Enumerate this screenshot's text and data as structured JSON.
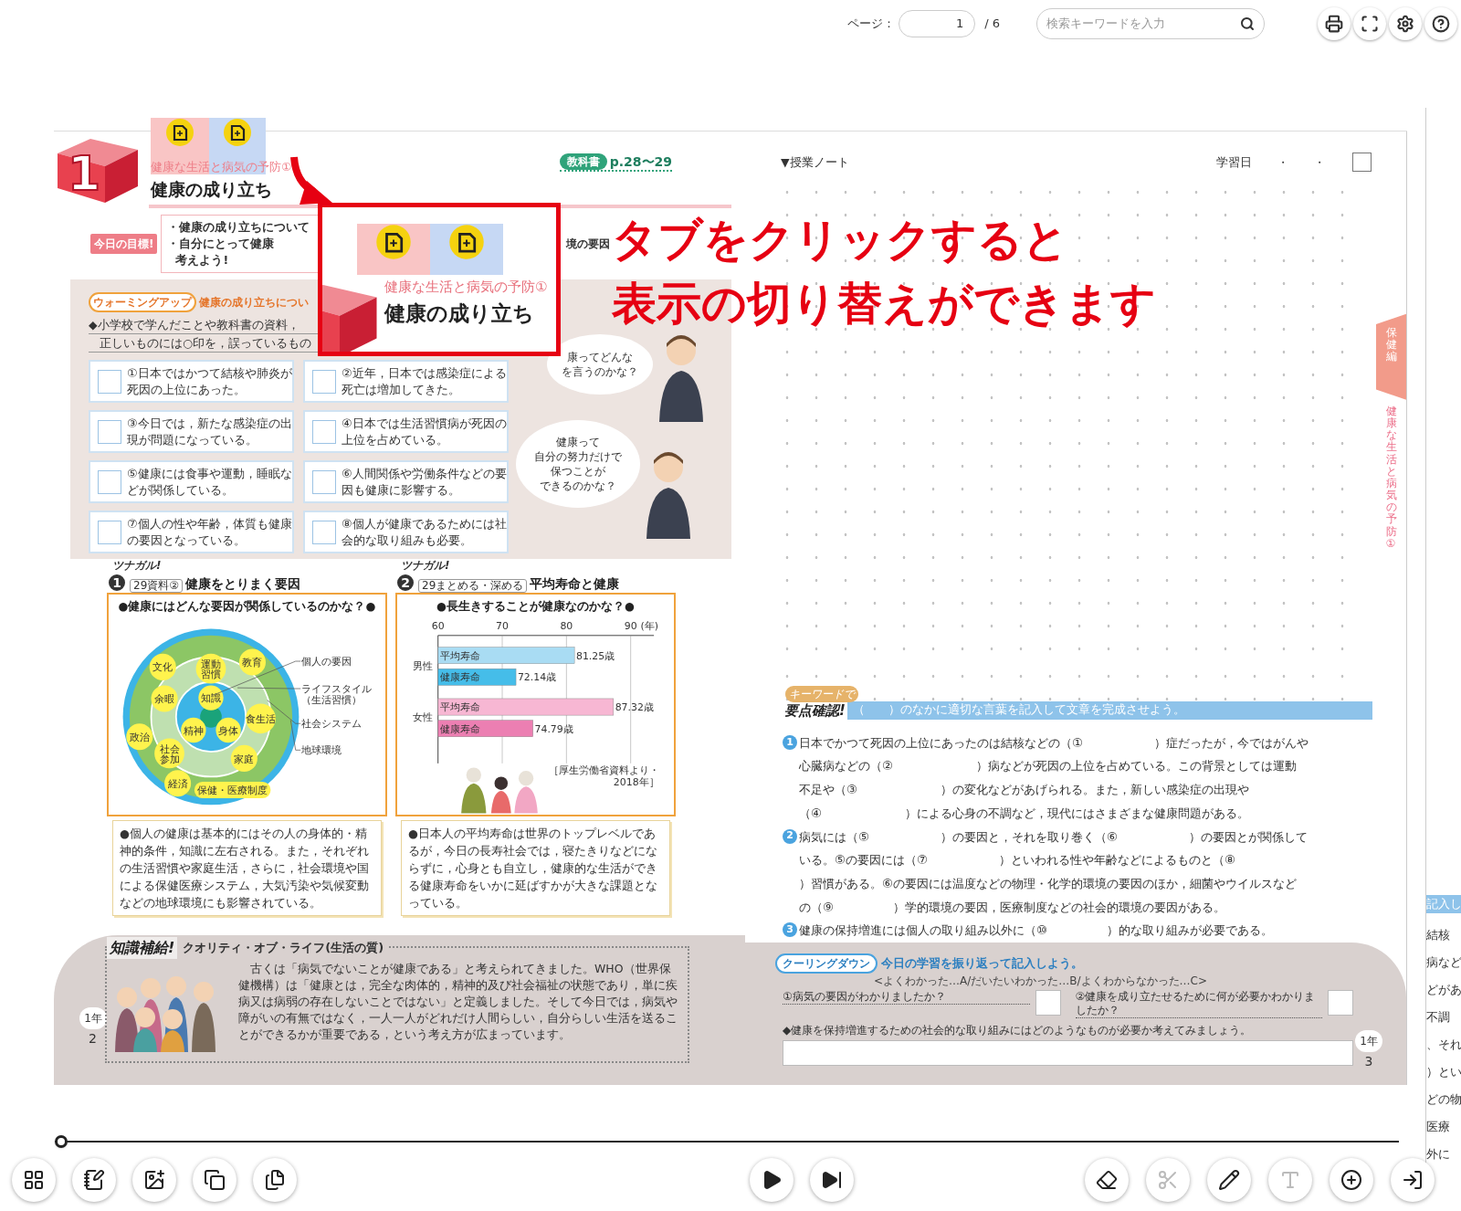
{
  "top_bar": {
    "page_label": "ページ：",
    "page_value": "1",
    "page_total": "/ 6",
    "search": {
      "placeholder": "検索キーワードを入力"
    }
  },
  "left_page": {
    "lesson_number": "1",
    "subtitle": "健康な生活と病気の予防①",
    "title": "健康の成り立ち",
    "textbook_badge": "教科書",
    "textbook_pages": "p.28〜29",
    "goal_badge": "今日の目標!",
    "goal_lines": [
      "・健康の成り立ちについて",
      "・自分にとって健康",
      "考えよう!"
    ],
    "goal_right_text": "境の要因",
    "warmup": {
      "badge": "ウォーミングアップ",
      "heading": "健康の成り立ちについ",
      "instruction_lines": [
        "◆小学校で学んだことや教科書の資料，",
        "正しいものには○印を，誤っているもの"
      ],
      "statements": [
        {
          "checked": false,
          "text": "①日本ではかつて結核や肺炎が死因の上位にあった。"
        },
        {
          "checked": false,
          "text": "②近年，日本では感染症による死亡は増加してきた。"
        },
        {
          "checked": false,
          "text": "③今日では，新たな感染症の出現が問題になっている。"
        },
        {
          "checked": false,
          "text": "④日本では生活習慣病が死因の上位を占めている。"
        },
        {
          "checked": false,
          "text": "⑤健康には食事や運動，睡眠などが関係している。"
        },
        {
          "checked": false,
          "text": "⑥人間関係や労働条件などの要因も健康に影響する。"
        },
        {
          "checked": false,
          "text": "⑦個人の性や年齢，体質も健康の要因となっている。"
        },
        {
          "checked": false,
          "text": "⑧個人が健康であるためには社会的な取り組みも必要。"
        }
      ],
      "bubbles": [
        {
          "lines": [
            "康ってどんな",
            "を言うのかな？"
          ]
        },
        {
          "lines": [
            "健康って",
            "自分の努力だけで",
            "保つことが",
            "できるのかな？"
          ]
        }
      ]
    },
    "sources": [
      {
        "tag": "ツナガル!",
        "number": "1",
        "ref": "29資料②",
        "title": "健康をとりまく要因",
        "question": "●健康にはどんな要因が関係しているのかな？●",
        "factors": [
          {
            "label": "文化"
          },
          {
            "label": "運動習慣"
          },
          {
            "label": "教育"
          },
          {
            "label": "余暇"
          },
          {
            "label": "知識"
          },
          {
            "label": "食生活"
          },
          {
            "label": "精神"
          },
          {
            "label": "身体"
          },
          {
            "label": "政治"
          },
          {
            "label": "社会参加"
          },
          {
            "label": "家庭"
          },
          {
            "label": "経済"
          },
          {
            "label": "保健・医療制度"
          }
        ],
        "legend": [
          {
            "lines": [
              "個人の要因"
            ]
          },
          {
            "lines": [
              "ライフスタイル",
              "（生活習慣）"
            ]
          },
          {
            "lines": [
              "社会システム"
            ]
          },
          {
            "lines": [
              "地球環境"
            ]
          }
        ],
        "caption": "●個人の健康は基本的にはその人の身体的・精神的条件，知識に左右される。また，それぞれの生活習慣や家庭生活，さらに，社会環境や国による保健医療システム，大気汚染や気候変動などの地球環境にも影響されている。"
      },
      {
        "tag": "ツナガル!",
        "number": "2",
        "ref": "29まとめる・深める",
        "title": "平均寿命と健康",
        "question": "●長生きすることが健康なのかな？●",
        "chart_data": {
          "type": "bar",
          "orientation": "horizontal",
          "xlabel": "(年)",
          "categories": [
            "男性",
            "女性"
          ],
          "xlim": [
            60,
            90
          ],
          "xticks": [
            60,
            70,
            80,
            90
          ],
          "series": [
            {
              "name": "平均寿命",
              "colors": [
                "#a9dcf3",
                "#f7b7d3"
              ],
              "values": [
                81.25,
                87.32
              ]
            },
            {
              "name": "健康寿命",
              "colors": [
                "#45bde9",
                "#ec7fb2"
              ],
              "values": [
                72.14,
                74.79
              ]
            }
          ],
          "value_labels": [
            [
              "81.25歳",
              "87.32歳"
            ],
            [
              "72.14歳",
              "74.79歳"
            ]
          ]
        },
        "source_lines": [
          "［厚生労働省資料より・",
          "2018年］"
        ],
        "caption": "●日本人の平均寿命は世界のトップレベルであるが，今日の長寿社会では，寝たきりなどにならずに，心身とも自立し，健康的な生活ができる健康寿命をいかに延ばすかが大きな課題となっている。"
      }
    ],
    "knowledge": {
      "badge": "知識補給!",
      "title": "クオリティ・オブ・ライフ(生活の質)",
      "text": "　古くは「病気でないことが健康である」と考えられてきました。WHO（世界保健機構）は「健康とは，完全な肉体的，精神的及び社会福祉の状態であり，単に疾病又は病弱の存在しないことではない」と定義しました。そして今日では，病気や障がいの有無ではなく，一人一人がどれだけ人間らしい，自分らしい生活を送ることができるかが重要である，という考え方が広まっています。"
    },
    "grade": "1年",
    "page_number": "2"
  },
  "overlay": {
    "subtitle": "健康な生活と病気の予防①",
    "title": "健康の成り立ち",
    "message_lines": [
      "タブをクリックすると",
      "表示の切り替えができます"
    ]
  },
  "right_page": {
    "note_label": "▼授業ノート",
    "date_label": "学習日",
    "date_dots": [
      "・",
      "・"
    ],
    "date_checked": false,
    "side_tab": "保健編",
    "side_title": "健康な生活と病気の予防①",
    "keypoints": {
      "tag": "キーワードで",
      "badge": "要点確認!",
      "instruction": "（　　）のなかに適切な言葉を記入して文章を完成させよう。",
      "items": [
        {
          "number": "1",
          "lines": [
            "日本でかつて死因の上位にあったのは結核などの（①　　　　　　）症だったが，今ではがんや",
            "心臓病などの（②　　　　　　　）病などが死因の上位を占めている。この背景としては運動",
            "不足や（③　　　　　　　）の変化などがあげられる。また，新しい感染症の出現や",
            "（④　　　　　　　）による心身の不調など，現代にはさまざまな健康問題がある。"
          ]
        },
        {
          "number": "2",
          "lines": [
            "病気には（⑤　　　　　　）の要因と，それを取り巻く（⑥　　　　　　）の要因とが関係して",
            "いる。⑤の要因には（⑦　　　　　　）といわれる性や年齢などによるものと（⑧",
            "）習慣がある。⑥の要因には温度などの物理・化学的環境の要因のほか，細菌やウイルスなど",
            "の（⑨　　　　　）学的環境の要因，医療制度などの社会的環境の要因がある。"
          ]
        },
        {
          "number": "3",
          "lines": [
            "健康の保持増進には個人の取り組み以外に（⑩　　　　　）的な取り組みが必要である。"
          ]
        }
      ]
    },
    "cooldown": {
      "badge": "クーリングダウン",
      "heading": "今日の学習を振り返って記入しよう。",
      "scale": "<よくわかった…A/だいたいわかった…B/よくわからなかった…C>",
      "questions": [
        "①病気の要因がわかりましたか？",
        "②健康を成り立たせるために何が必要かわかりましたか？"
      ],
      "prompt": "◆健康を保持増進するための社会的な取り組みにはどのようなものが必要か考えてみましょう。"
    },
    "grade": "1年",
    "page_number": "3"
  },
  "next_page_peek": [
    "記入し",
    "結核",
    "病など",
    "どがあ",
    "不調",
    "、それ",
    "）とい",
    "どの物",
    "医療",
    "外に"
  ],
  "slider": {
    "level": 0
  },
  "bottom_toolbar": [
    {
      "kind": "grid",
      "disabled": false
    },
    {
      "kind": "notebook",
      "disabled": false
    },
    {
      "kind": "image",
      "disabled": false
    },
    {
      "kind": "copy",
      "disabled": false
    },
    {
      "kind": "tab",
      "disabled": false
    },
    {
      "kind": "play",
      "disabled": false
    },
    {
      "kind": "next",
      "disabled": false
    },
    {
      "kind": "eraser",
      "disabled": false
    },
    {
      "kind": "scissors",
      "disabled": true
    },
    {
      "kind": "pen",
      "disabled": false
    },
    {
      "kind": "textbox",
      "disabled": true
    },
    {
      "kind": "zoom",
      "disabled": false
    },
    {
      "kind": "exit",
      "disabled": false
    }
  ]
}
